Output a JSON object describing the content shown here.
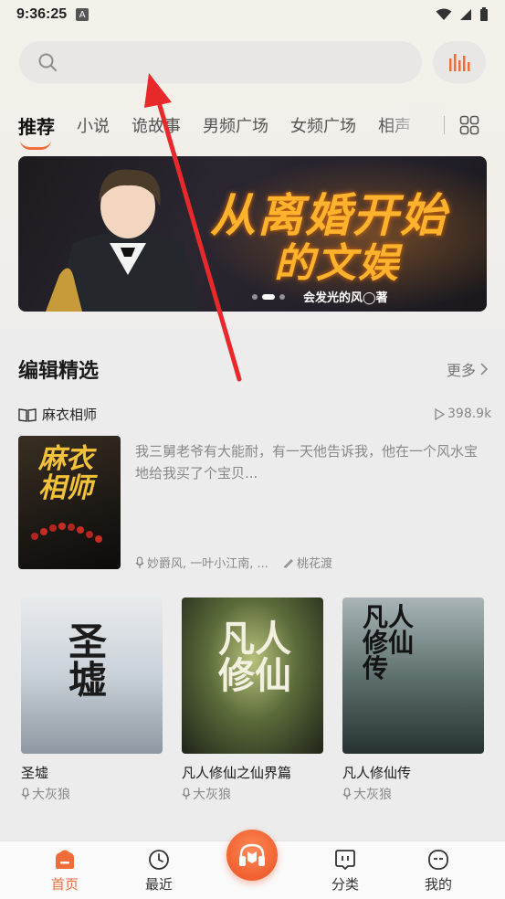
{
  "status_bar": {
    "time": "9:36:25",
    "notif_icon": "A"
  },
  "search": {
    "placeholder": ""
  },
  "tabs": [
    {
      "label": "推荐",
      "active": true
    },
    {
      "label": "小说",
      "active": false
    },
    {
      "label": "诡故事",
      "active": false
    },
    {
      "label": "男频广场",
      "active": false
    },
    {
      "label": "女频广场",
      "active": false
    },
    {
      "label": "相声",
      "active": false
    }
  ],
  "banner": {
    "title_line1": "从离婚开始",
    "title_line2": "的文娱",
    "caption": "会发光的风◯著",
    "dot_count": 3,
    "active_dot": 1
  },
  "editor_picks": {
    "title": "编辑精选",
    "more_label": "更多",
    "featured": {
      "title": "麻衣相师",
      "plays": "398.9k",
      "cover_text": "麻衣相师",
      "description": "我三舅老爷有大能耐，有一天他告诉我，他在一个风水宝地给我买了个宝贝...",
      "narrators": "妙爵风, 一叶小江南, ...",
      "author": "桃花渡"
    },
    "books": [
      {
        "title": "圣墟",
        "author": "大灰狼",
        "cover_text": "圣墟"
      },
      {
        "title": "凡人修仙之仙界篇",
        "author": "大灰狼",
        "cover_text": "凡人修仙"
      },
      {
        "title": "凡人修仙传",
        "author": "大灰狼",
        "cover_text": "凡人修仙传"
      }
    ]
  },
  "bottom_nav": [
    {
      "label": "首页",
      "icon": "home-icon",
      "active": true
    },
    {
      "label": "最近",
      "icon": "clock-icon",
      "active": false
    },
    {
      "label": "",
      "icon": "headphones-icon",
      "active": false
    },
    {
      "label": "分类",
      "icon": "category-icon",
      "active": false
    },
    {
      "label": "我的",
      "icon": "profile-icon",
      "active": false
    }
  ],
  "colors": {
    "accent": "#f06d3a",
    "annotation_arrow": "#e8292b"
  }
}
